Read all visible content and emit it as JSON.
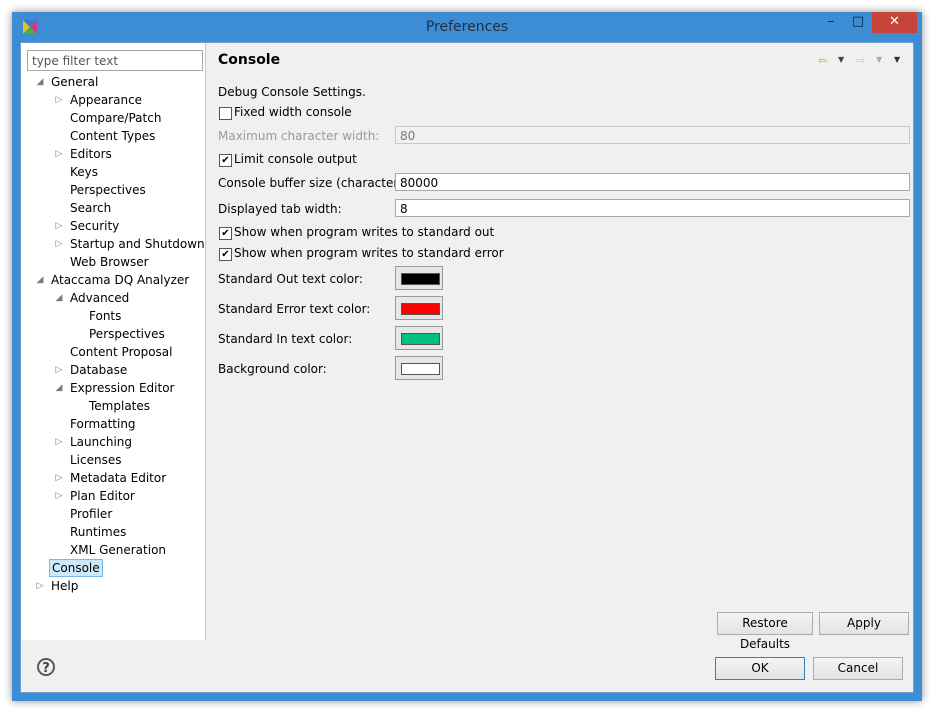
{
  "window": {
    "title": "Preferences",
    "min_glyph": "–",
    "max_glyph": "□",
    "close_glyph": "✕"
  },
  "sidebar": {
    "filter_placeholder": "type filter text",
    "items": [
      {
        "label": "General",
        "state": "expanded"
      },
      {
        "label": "Appearance",
        "state": "collapsed"
      },
      {
        "label": "Compare/Patch",
        "state": "leaf"
      },
      {
        "label": "Content Types",
        "state": "leaf"
      },
      {
        "label": "Editors",
        "state": "collapsed"
      },
      {
        "label": "Keys",
        "state": "leaf"
      },
      {
        "label": "Perspectives",
        "state": "leaf"
      },
      {
        "label": "Search",
        "state": "leaf"
      },
      {
        "label": "Security",
        "state": "collapsed"
      },
      {
        "label": "Startup and Shutdown",
        "state": "collapsed"
      },
      {
        "label": "Web Browser",
        "state": "leaf"
      },
      {
        "label": "Ataccama DQ Analyzer",
        "state": "expanded"
      },
      {
        "label": "Advanced",
        "state": "expanded"
      },
      {
        "label": "Fonts",
        "state": "leaf"
      },
      {
        "label": "Perspectives",
        "state": "leaf"
      },
      {
        "label": "Content Proposal",
        "state": "leaf"
      },
      {
        "label": "Database",
        "state": "collapsed"
      },
      {
        "label": "Expression Editor",
        "state": "expanded"
      },
      {
        "label": "Templates",
        "state": "leaf"
      },
      {
        "label": "Formatting",
        "state": "leaf"
      },
      {
        "label": "Launching",
        "state": "collapsed"
      },
      {
        "label": "Licenses",
        "state": "leaf"
      },
      {
        "label": "Metadata Editor",
        "state": "collapsed"
      },
      {
        "label": "Plan Editor",
        "state": "collapsed"
      },
      {
        "label": "Profiler",
        "state": "leaf"
      },
      {
        "label": "Runtimes",
        "state": "leaf"
      },
      {
        "label": "XML Generation",
        "state": "leaf"
      },
      {
        "label": "Console",
        "state": "leaf",
        "selected": true
      },
      {
        "label": "Help",
        "state": "collapsed"
      }
    ]
  },
  "page": {
    "title": "Console",
    "back_icon": "back-arrow-icon",
    "forward_icon": "forward-arrow-icon",
    "description": "Debug Console Settings.",
    "fixed_width": {
      "label": "Fixed width console",
      "checked": false
    },
    "max_char_width": {
      "label": "Maximum character width:",
      "value": "80",
      "enabled": false
    },
    "limit_output": {
      "label": "Limit console output",
      "checked": true
    },
    "buffer_size": {
      "label": "Console buffer size (characters):",
      "value": "80000"
    },
    "tab_width": {
      "label": "Displayed tab width:",
      "value": "8"
    },
    "show_stdout": {
      "label": "Show when program writes to standard out",
      "checked": true
    },
    "show_stderr": {
      "label": "Show when program writes to standard error",
      "checked": true
    },
    "colors": [
      {
        "label": "Standard Out text color:",
        "color": "#000000"
      },
      {
        "label": "Standard Error text color:",
        "color": "#ff0000"
      },
      {
        "label": "Standard In text color:",
        "color": "#00c080"
      },
      {
        "label": "Background color:",
        "color": "#ffffff"
      }
    ],
    "restore_defaults_label": "Restore Defaults",
    "apply_label": "Apply"
  },
  "footer": {
    "help_glyph": "?",
    "ok_label": "OK",
    "cancel_label": "Cancel"
  }
}
